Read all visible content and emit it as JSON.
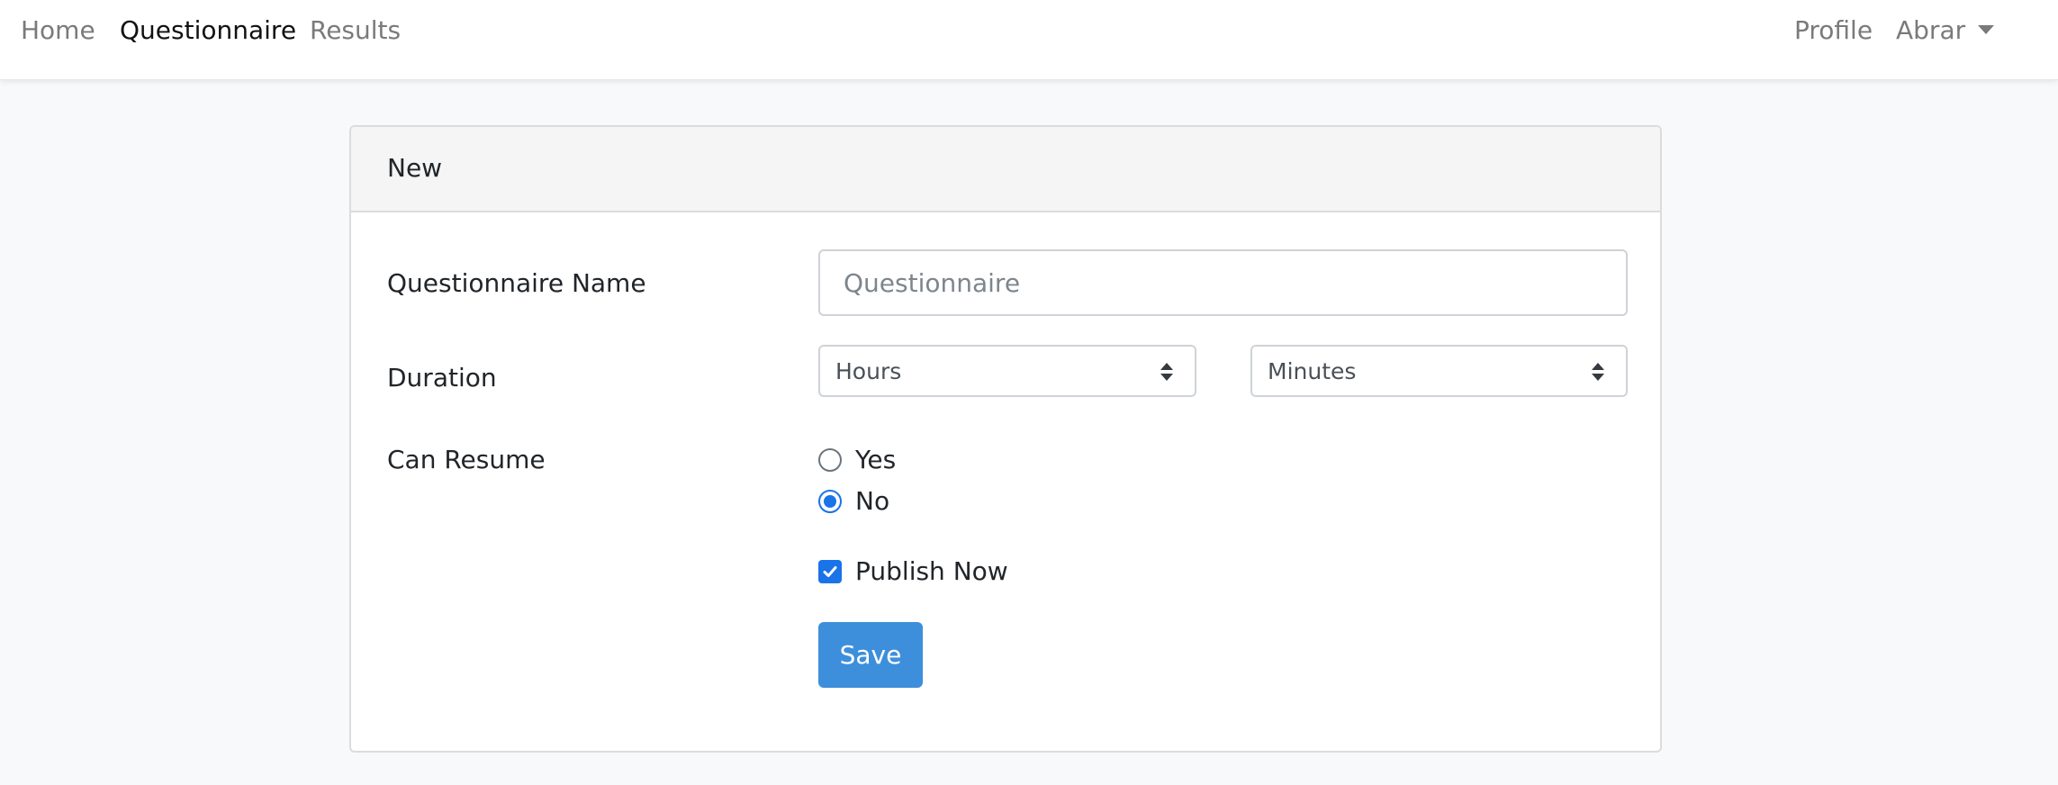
{
  "navbar": {
    "links": [
      {
        "label": "Home",
        "active": false
      },
      {
        "label": "Questionnaire",
        "active": true
      },
      {
        "label": "Results",
        "active": false
      }
    ],
    "profile_label": "Profile",
    "user_label": "Abrar"
  },
  "card": {
    "title": "New",
    "fields": {
      "name_label": "Questionnaire Name",
      "name_placeholder": "Questionnaire",
      "name_value": "",
      "duration_label": "Duration",
      "hours_selected": "Hours",
      "minutes_selected": "Minutes",
      "resume_label": "Can Resume",
      "resume_options": [
        {
          "label": "Yes",
          "checked": false
        },
        {
          "label": "No",
          "checked": true
        }
      ],
      "publish_label": "Publish Now",
      "publish_checked": true
    },
    "save_label": "Save"
  },
  "colors": {
    "primary": "#3d8fdb",
    "control_accent": "#1a73e8",
    "page_background": "#f8f9fb"
  },
  "icons": {
    "user_menu": "caret-down-icon",
    "select": "select-arrows-icon",
    "checkbox": "check-icon"
  }
}
